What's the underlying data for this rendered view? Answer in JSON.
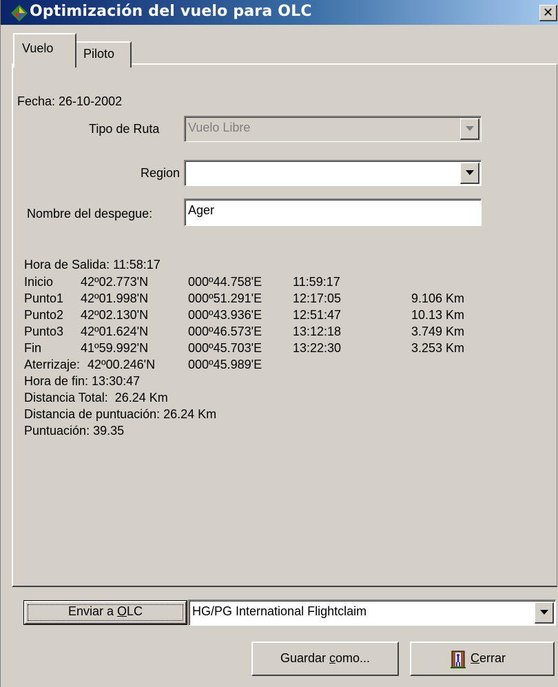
{
  "window": {
    "title": "Optimización del vuelo para OLC"
  },
  "tabs": {
    "vuelo": "Vuelo",
    "piloto": "Piloto"
  },
  "form": {
    "fecha": "Fecha: 26-10-2002",
    "tipo_ruta_label": "Tipo de Ruta",
    "tipo_ruta_value": "Vuelo Libre",
    "region_label": "Region",
    "region_value": "",
    "despegue_label": "Nombre del despegue:",
    "despegue_value": "Ager"
  },
  "flight": {
    "hora_salida": "Hora de Salida: 11:58:17",
    "points": [
      {
        "name": "Inicio",
        "lat": "42º02.773'N",
        "lon": "000º44.758'E",
        "time": "11:59:17",
        "dist": ""
      },
      {
        "name": "Punto1",
        "lat": "42º01.998'N",
        "lon": "000º51.291'E",
        "time": "12:17:05",
        "dist": "9.106 Km"
      },
      {
        "name": "Punto2",
        "lat": "42º02.130'N",
        "lon": "000º43.936'E",
        "time": "12:51:47",
        "dist": "10.13 Km"
      },
      {
        "name": "Punto3",
        "lat": "42º01.624'N",
        "lon": "000º46.573'E",
        "time": "13:12:18",
        "dist": "3.749 Km"
      },
      {
        "name": "Fin",
        "lat": "41º59.992'N",
        "lon": "000º45.703'E",
        "time": "13:22:30",
        "dist": "3.253 Km"
      }
    ],
    "aterrizaje_name": "Aterrizaje:",
    "aterrizaje_lat": "42º00.246'N",
    "aterrizaje_lon": "000º45.989'E",
    "hora_fin": "Hora de fin: 13:30:47",
    "distancia_total": "Distancia Total:  26.24 Km",
    "distancia_puntuacion": "Distancia de puntuación: 26.24 Km",
    "puntuacion": "Puntuación: 39.35"
  },
  "bottom": {
    "enviar_pre": "Enviar a ",
    "enviar_ul": "O",
    "enviar_post": "LC",
    "claim_value": "HG/PG International Flightclaim",
    "guardar_pre": "Guardar ",
    "guardar_ul": "c",
    "guardar_post": "omo...",
    "cerrar_ul": "C",
    "cerrar_post": "errar"
  }
}
